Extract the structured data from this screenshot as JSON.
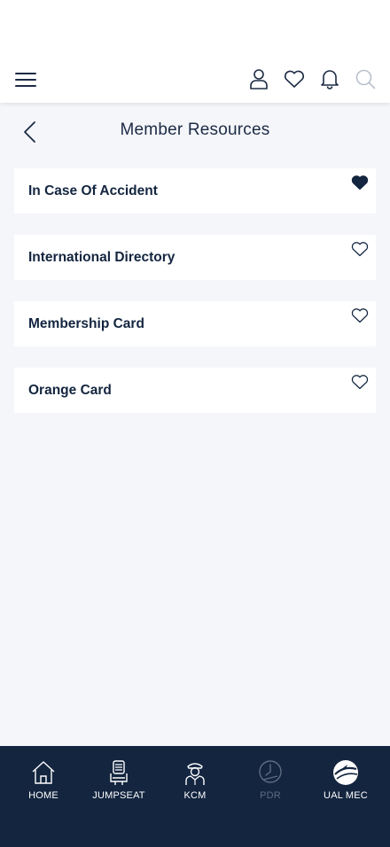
{
  "header": {
    "title": "Member Resources"
  },
  "resources": [
    {
      "label": "In Case Of Accident",
      "favorited": true
    },
    {
      "label": "International Directory",
      "favorited": false
    },
    {
      "label": "Membership Card",
      "favorited": false
    },
    {
      "label": "Orange Card",
      "favorited": false
    }
  ],
  "bottom_nav": [
    {
      "label": "HOME",
      "icon": "home-icon",
      "disabled": false
    },
    {
      "label": "JUMPSEAT",
      "icon": "jumpseat-icon",
      "disabled": false
    },
    {
      "label": "KCM",
      "icon": "pilot-icon",
      "disabled": false
    },
    {
      "label": "PDR",
      "icon": "pdr-icon",
      "disabled": true
    },
    {
      "label": "UAL MEC",
      "icon": "ual-mec-logo-icon",
      "disabled": false
    }
  ],
  "colors": {
    "navy": "#13253f",
    "background": "#f4f6fa",
    "card": "#ffffff",
    "disabled": "#5d6c82"
  }
}
